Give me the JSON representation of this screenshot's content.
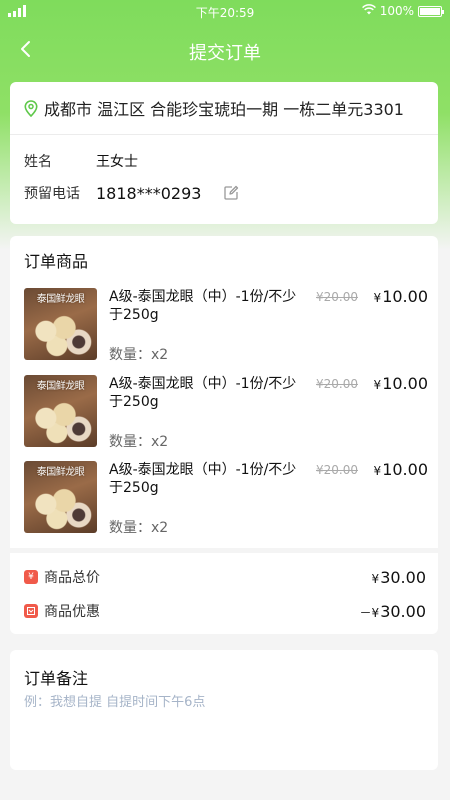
{
  "status_bar": {
    "time": "下午20:59",
    "battery": "100%"
  },
  "nav": {
    "title": "提交订单"
  },
  "address": {
    "text": "成都市 温江区 合能珍宝琥珀一期   一栋二单元3301",
    "name_label": "姓名",
    "name_value": "王女士",
    "phone_label": "预留电话",
    "phone_value": "1818***0293"
  },
  "goods": {
    "title": "订单商品",
    "items": [
      {
        "thumb_tag": "泰国鲜龙眼",
        "name": "A级-泰国龙眼（中）-1份/不少于250g",
        "original_price": "¥20.00",
        "currency": "¥",
        "price": "10.00",
        "quantity": "数量：x2"
      },
      {
        "thumb_tag": "泰国鲜龙眼",
        "name": "A级-泰国龙眼（中）-1份/不少于250g",
        "original_price": "¥20.00",
        "currency": "¥",
        "price": "10.00",
        "quantity": "数量：x2"
      },
      {
        "thumb_tag": "泰国鲜龙眼",
        "name": "A级-泰国龙眼（中）-1份/不少于250g",
        "original_price": "¥20.00",
        "currency": "¥",
        "price": "10.00",
        "quantity": "数量：x2"
      }
    ]
  },
  "summary": {
    "total_label": "商品总价",
    "total_currency": "¥",
    "total_value": "30.00",
    "discount_label": "商品优惠",
    "discount_prefix": "－¥",
    "discount_value": "30.00"
  },
  "remark": {
    "title": "订单备注",
    "placeholder": "例：我想自提 自提时间下午6点"
  },
  "colors": {
    "accent_green": "#7fdc5c",
    "location_icon": "#5fc84a",
    "summary_icon": "#f05a4a"
  }
}
